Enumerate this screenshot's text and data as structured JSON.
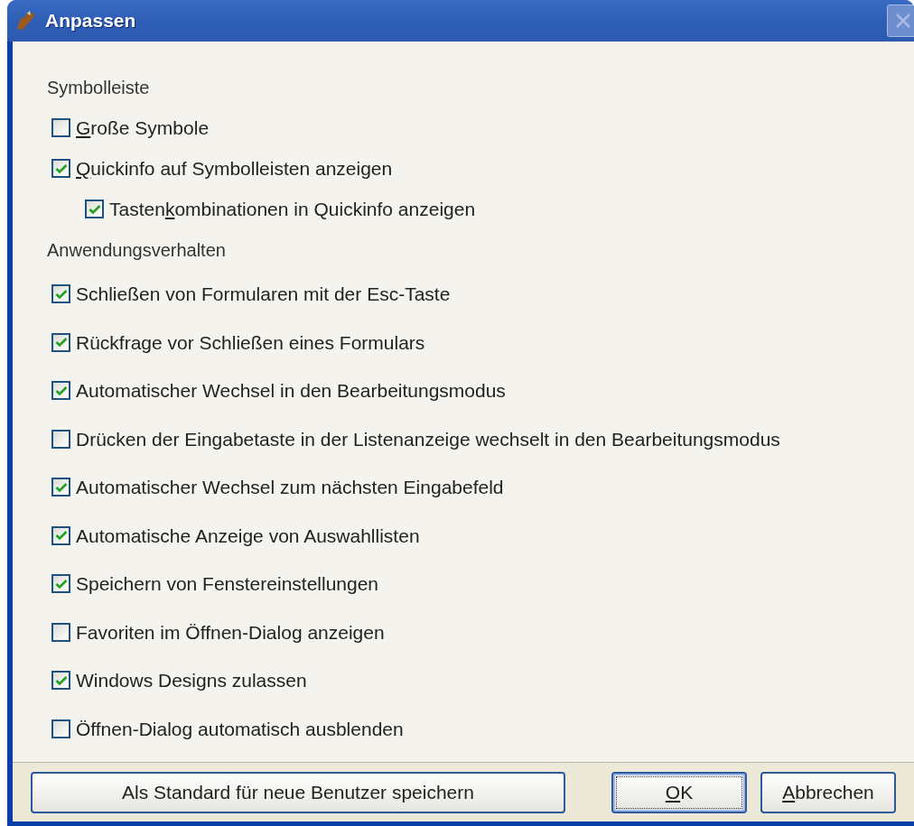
{
  "window": {
    "title": "Anpassen",
    "close_disabled": true
  },
  "sections": [
    {
      "heading": "Symbolleiste",
      "options": [
        {
          "text": [
            {
              "t": "G",
              "underline": true
            },
            {
              "t": "roße Symbole",
              "underline": false
            }
          ],
          "checked": false
        },
        {
          "text": [
            {
              "t": "Q",
              "underline": true
            },
            {
              "t": "uickinfo auf Symbolleisten anzeigen",
              "underline": false
            }
          ],
          "checked": true,
          "children": [
            {
              "text": [
                {
                  "t": "Tasten",
                  "underline": false
                },
                {
                  "t": "k",
                  "underline": true
                },
                {
                  "t": "ombinationen in Quickinfo anzeigen",
                  "underline": false
                }
              ],
              "checked": true
            }
          ]
        }
      ]
    },
    {
      "heading": "Anwendungsverhalten",
      "options": [
        {
          "text": [
            {
              "t": "Schließen von Formularen mit der Esc-Taste",
              "underline": false
            }
          ],
          "checked": true
        },
        {
          "text": [
            {
              "t": "Rückfrage vor Schließen eines Formulars",
              "underline": false
            }
          ],
          "checked": true
        },
        {
          "text": [
            {
              "t": "Automatischer Wechsel in den Bearbeitungsmodus",
              "underline": false
            }
          ],
          "checked": true
        },
        {
          "text": [
            {
              "t": "Drücken der Eingabetaste in der Listenanzeige wechselt in den Bearbeitungsmodus",
              "underline": false
            }
          ],
          "checked": false
        },
        {
          "text": [
            {
              "t": "Automatischer Wechsel zum nächsten Eingabefeld",
              "underline": false
            }
          ],
          "checked": true
        },
        {
          "text": [
            {
              "t": "Automatische Anzeige von Auswahllisten",
              "underline": false
            }
          ],
          "checked": true
        },
        {
          "text": [
            {
              "t": "Speichern von Fenstereinstellungen",
              "underline": false
            }
          ],
          "checked": true
        },
        {
          "text": [
            {
              "t": "Favoriten im Öffnen-Dialog anzeigen",
              "underline": false
            }
          ],
          "checked": false
        },
        {
          "text": [
            {
              "t": "Windows Designs zulassen",
              "underline": false
            }
          ],
          "checked": true
        },
        {
          "text": [
            {
              "t": "Öffnen-Dialog automatisch ausblenden",
              "underline": false
            }
          ],
          "checked": false
        }
      ]
    }
  ],
  "buttons": [
    {
      "kind": "wide",
      "text": [
        {
          "t": "Als Standard für neue Benutzer speichern",
          "underline": false
        }
      ],
      "focused": false
    },
    {
      "kind": "normal",
      "text": [
        {
          "t": "O",
          "underline": true
        },
        {
          "t": "K",
          "underline": false
        }
      ],
      "focused": true
    },
    {
      "kind": "normal",
      "text": [
        {
          "t": "A",
          "underline": true
        },
        {
          "t": "bbrechen",
          "underline": false
        }
      ],
      "focused": false
    }
  ]
}
